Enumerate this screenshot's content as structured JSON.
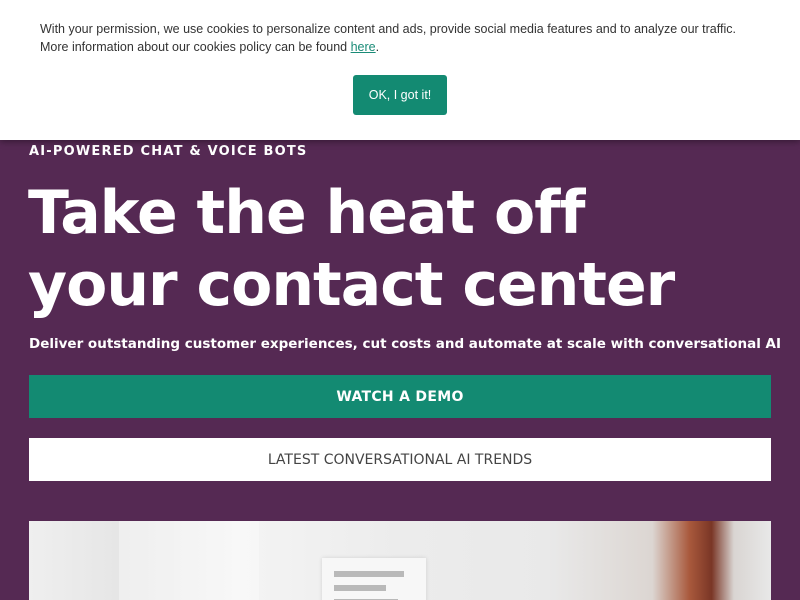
{
  "cookie_banner": {
    "message": "With your permission, we use cookies to personalize content and ads, provide social media features and to analyze our traffic. More information about our cookies policy can be found ",
    "link_text": "here",
    "message_end": ".",
    "ok_label": "OK, I got it!"
  },
  "hero": {
    "eyebrow": "AI-POWERED CHAT & VOICE BOTS",
    "headline_line1": "Take the heat off",
    "headline_line2": "your contact center",
    "subhead": "Deliver outstanding customer experiences, cut costs and automate at scale with conversational AI",
    "primary_cta": "WATCH A DEMO",
    "secondary_cta": "LATEST CONVERSATIONAL AI TRENDS"
  },
  "colors": {
    "background": "#552953",
    "accent": "#138a72",
    "banner": "#ffffff"
  },
  "icons": {
    "hero_image": "photo-of-document-on-desk"
  }
}
